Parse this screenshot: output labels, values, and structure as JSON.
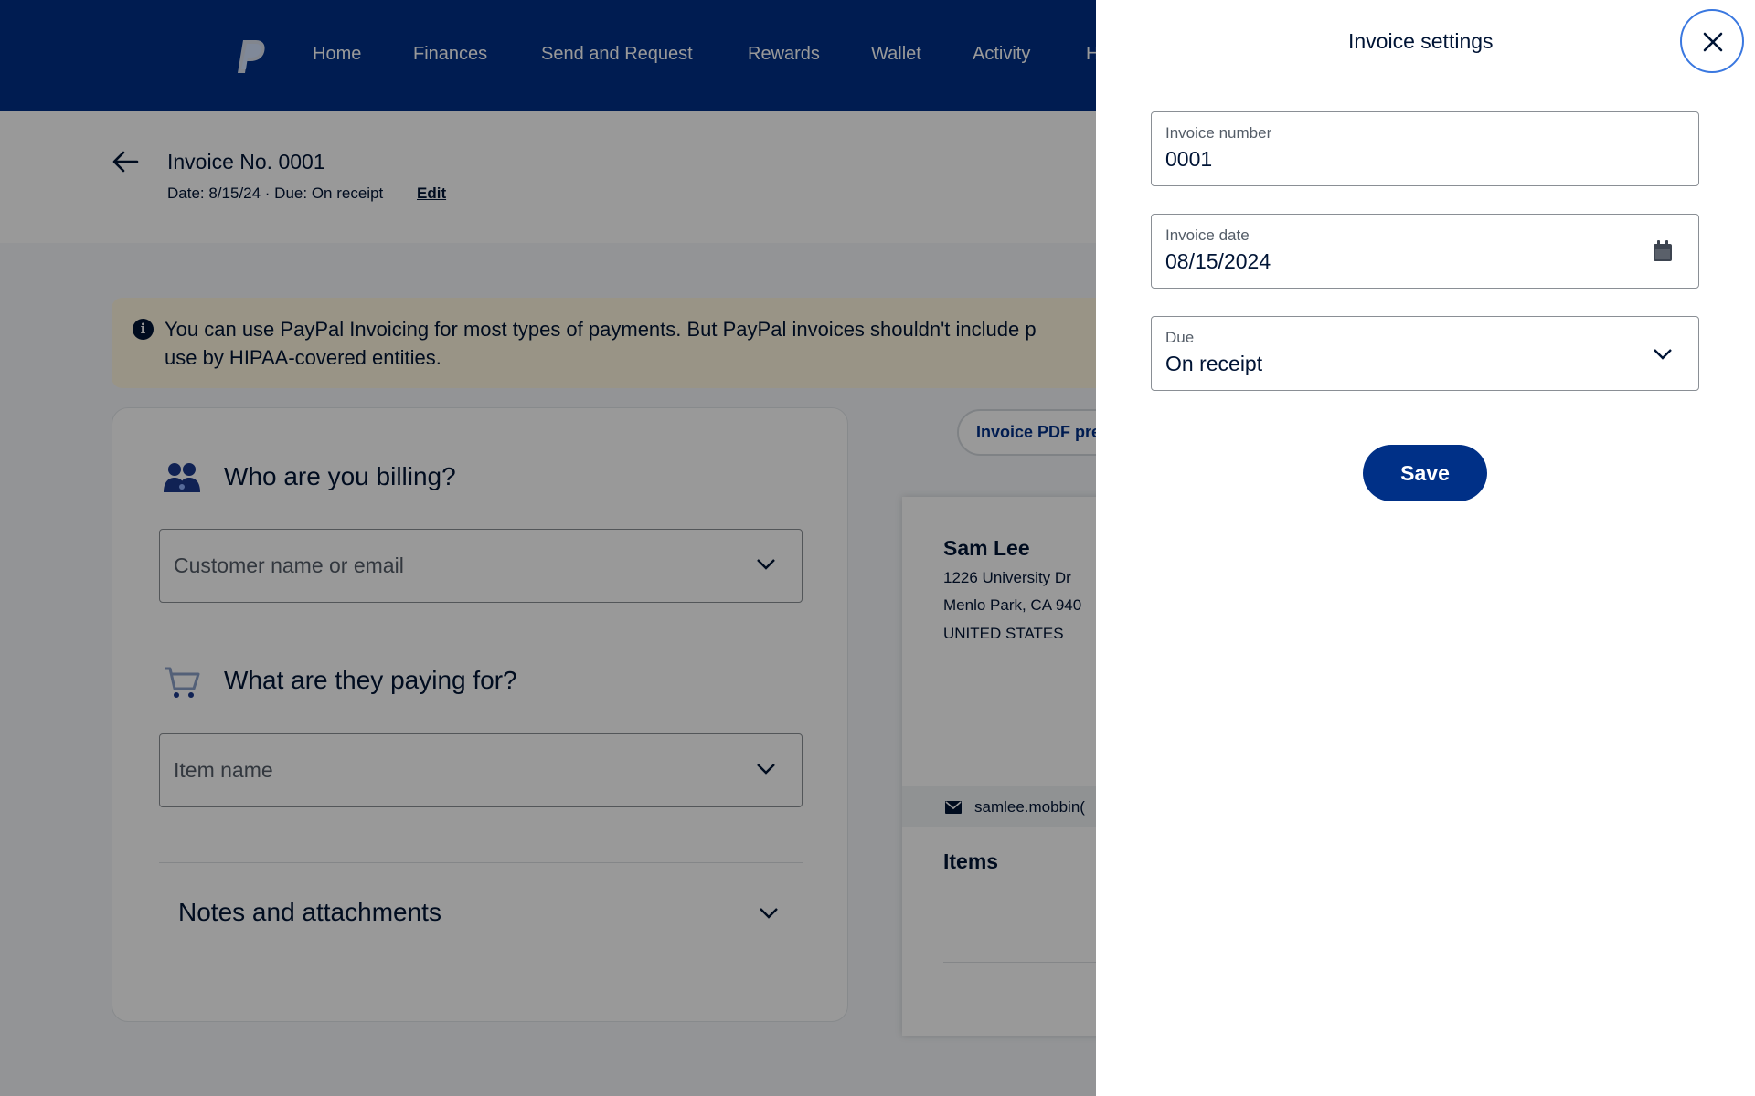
{
  "nav": {
    "items": [
      "Home",
      "Finances",
      "Send and Request",
      "Rewards",
      "Wallet",
      "Activity",
      "H"
    ]
  },
  "invoice_header": {
    "title": "Invoice No. 0001",
    "meta": "Date: 8/15/24 · Due: On receipt",
    "edit_label": "Edit"
  },
  "notice": {
    "text": "You can use PayPal Invoicing for most types of payments. But PayPal invoices shouldn't include p​use by HIPAA-covered entities.",
    "line1": "You can use PayPal Invoicing for most types of payments. But PayPal invoices shouldn't include p",
    "line2": "use by HIPAA-covered entities."
  },
  "billing": {
    "title": "Who are you billing?",
    "placeholder": "Customer name or email"
  },
  "paying": {
    "title": "What are they paying for?",
    "placeholder": "Item name"
  },
  "notes": {
    "title": "Notes and attachments"
  },
  "preview": {
    "pill_label": "Invoice PDF pre",
    "name": "Sam Lee",
    "address_line1": "1226 University Dr",
    "address_line2": "Menlo Park, CA 940",
    "country": "UNITED STATES",
    "email": "samlee.mobbin(",
    "items_label": "Items"
  },
  "panel": {
    "title": "Invoice settings",
    "fields": {
      "number": {
        "label": "Invoice number",
        "value": "0001"
      },
      "date": {
        "label": "Invoice date",
        "value": "08/15/2024"
      },
      "due": {
        "label": "Due",
        "value": "On receipt"
      }
    },
    "save_label": "Save"
  },
  "colors": {
    "brand_navy": "#003087",
    "text_dark": "#001435",
    "focus_blue": "#3a78e0"
  }
}
